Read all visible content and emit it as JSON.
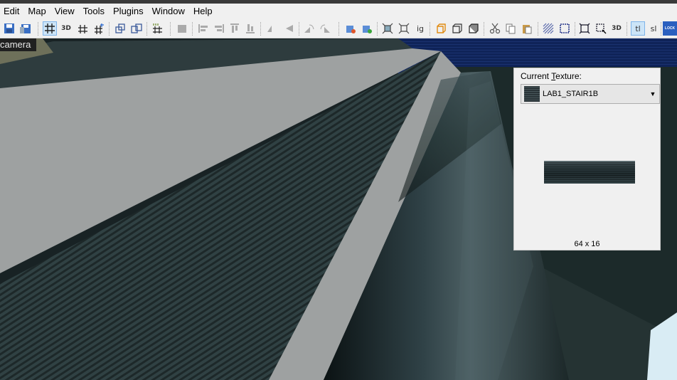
{
  "menu": [
    "Edit",
    "Map",
    "View",
    "Tools",
    "Plugins",
    "Window",
    "Help"
  ],
  "toolbar": {
    "button_3d": "3D",
    "button_ig": "ig",
    "button_3d_b": "3D",
    "button_tl": "tl",
    "button_sl": "sl",
    "button_lock": "LOCK"
  },
  "viewport": {
    "label": "camera"
  },
  "texture_panel": {
    "label_prefix": "Current ",
    "label_accel": "T",
    "label_suffix": "exture:",
    "selected_texture": "LAB1_STAIR1B",
    "size": "64 x 16"
  },
  "colors": {
    "sky": "#0d1f54",
    "wall_grey": "#9ea1a1",
    "stripes": "#2b3b3d",
    "toolbar_bg": "#f0f0f0"
  }
}
